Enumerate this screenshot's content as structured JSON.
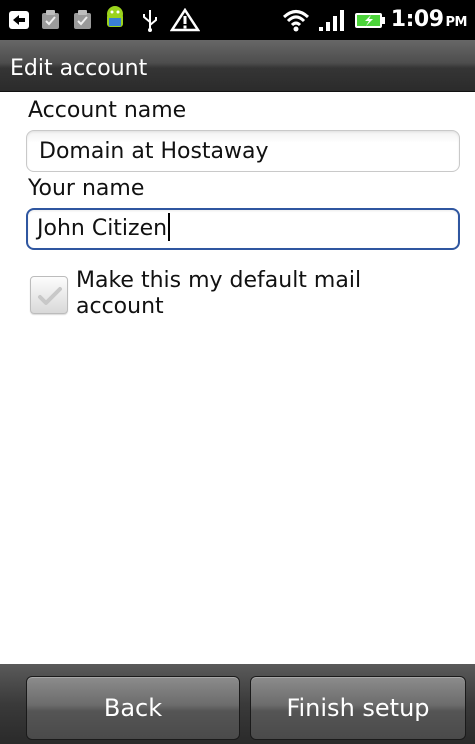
{
  "status_bar": {
    "icons": [
      "back-arrow-notification-icon",
      "task-done-icon",
      "task-done-icon",
      "android-bot-icon",
      "usb-icon",
      "warning-icon",
      "wifi-icon",
      "signal-icon",
      "battery-charging-icon"
    ],
    "time": "1:09",
    "ampm": "PM"
  },
  "title_bar": {
    "title": "Edit account"
  },
  "form": {
    "account_name_label": "Account name",
    "account_name_value": "Domain at Hostaway",
    "your_name_label": "Your name",
    "your_name_value": "John Citizen",
    "default_checkbox_label": "Make this my default mail account",
    "default_checkbox_checked": false
  },
  "buttons": {
    "back_label": "Back",
    "finish_label": "Finish setup"
  },
  "colors": {
    "focus_border": "#2f56a0",
    "battery_green": "#4cd43a"
  }
}
